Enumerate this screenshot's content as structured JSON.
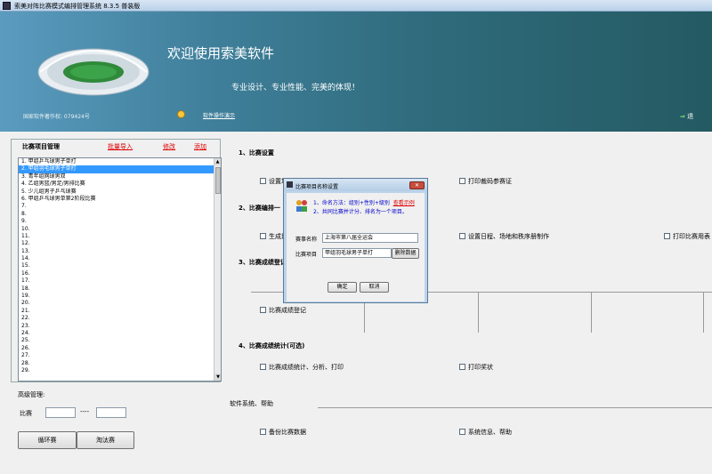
{
  "window": {
    "title": "索美对阵比赛模式编排管理系统  8.3.5  普装版"
  },
  "banner": {
    "welcome": "欢迎使用索美软件",
    "slogan": "专业设计、专业性能、完美的体现！",
    "copyright": "国家软件著作权: 079424号",
    "guide_link": "软件操作演示",
    "exit_label": "退"
  },
  "event_panel": {
    "title": "比赛项目管理",
    "import_link": "批量导入",
    "edit_link": "修改",
    "delete_link": "添加",
    "items": [
      "1.  甲组乒乓球男子单打",
      "2.  甲组羽毛球男子单打",
      "3.  青年组网球男双",
      "4.  乙组男篮/男足/男排比赛",
      "5.  少儿组男子乒乓球赛",
      "6.  甲组乒乓球男单第2阶段比赛",
      "7.",
      "8.",
      "9.",
      "10.",
      "11.",
      "12.",
      "13.",
      "14.",
      "15.",
      "16.",
      "17.",
      "18.",
      "19.",
      "20.",
      "21.",
      "22.",
      "23.",
      "24.",
      "25.",
      "26.",
      "27.",
      "28.",
      "29."
    ],
    "selected_index": 1
  },
  "advanced": {
    "label": "高级管理:",
    "match_label": "比赛",
    "range_sep": "----",
    "round_robin_button": "循环赛",
    "knockout_button": "淘汰赛"
  },
  "sections": {
    "s1_title": "1、比赛设置",
    "s1_set": "设置场",
    "s1_print_codes": "打印裁码参赛证",
    "s2_title": "2、比赛编排一",
    "s2_generate": "生成比",
    "s2_schedule": "设置日程、场地和秩序册制作",
    "s2_print_table": "打印比赛用表",
    "s3_title": "3、比赛成绩登记(",
    "s3_register": "比赛成绩登记",
    "s4_title": "4、比赛成绩统计(可选)",
    "s4_stats": "比赛成绩统计、分析、打印",
    "s4_print_awards": "打印奖状",
    "s5_title": "软件系统、帮助",
    "s5_backup": "备份比赛数据",
    "s5_sysinfo": "系统信息、帮助"
  },
  "dialog": {
    "title": "比赛项目名称设置",
    "tip1": "1、命名方法：组别+性别+级别",
    "tip1_link": "查看示例",
    "tip2": "2、共同比赛并计分、排名为一个项目。",
    "name_label": "赛事名称",
    "name_value": "上海市第八届全运会",
    "event_label": "比赛项目",
    "event_value": "甲组羽毛球男子单打",
    "delete_button": "删除数据",
    "ok_button": "确定",
    "cancel_button": "取消"
  }
}
